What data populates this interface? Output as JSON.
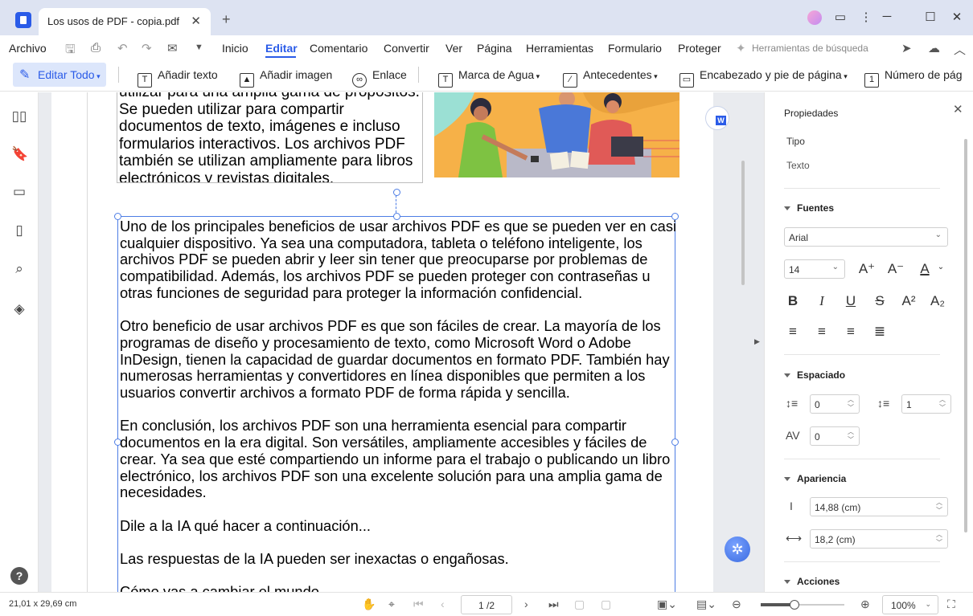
{
  "window": {
    "tab_title": "Los usos de PDF - copia.pdf",
    "tab_close": "✕",
    "new_tab": "+",
    "icons": [
      "avatar",
      "chat-icon",
      "more-icon",
      "minimize-icon",
      "maximize-icon",
      "close-icon"
    ]
  },
  "menu": {
    "file": "Archivo",
    "items": [
      "Inicio",
      "Editar",
      "Comentario",
      "Convertir",
      "Ver",
      "Página",
      "Herramientas",
      "Formulario",
      "Proteger"
    ],
    "active": "Editar",
    "search_tools": "Herramientas de búsqueda"
  },
  "toolbar": {
    "edit_all": "Editar Todo",
    "add_text": "Añadir texto",
    "add_image": "Añadir imagen",
    "link": "Enlace",
    "watermark": "Marca de Agua",
    "background": "Antecedentes",
    "header_footer": "Encabezado y pie de página",
    "page_number": "Número de pág"
  },
  "document": {
    "prev_paragraph": "utilizar para una amplia gama de propósitos. Se pueden utilizar para compartir documentos de texto, imágenes e incluso formularios interactivos. Los archivos PDF también se utilizan ampliamente para libros electrónicos y revistas digitales.",
    "paragraphs": [
      "Uno de los principales beneficios de usar archivos PDF es que se pueden ver en casi cualquier dispositivo. Ya sea una computadora, tableta o teléfono inteligente, los archivos PDF se pueden abrir y leer sin tener que preocuparse por problemas de compatibilidad. Además, los archivos PDF se pueden proteger con contraseñas u otras funciones de seguridad para proteger la información confidencial.",
      "Otro beneficio de usar archivos PDF es que son fáciles de crear. La mayoría de los programas de diseño y procesamiento de texto, como Microsoft Word o Adobe InDesign, tienen la capacidad de guardar documentos en formato PDF. También hay numerosas herramientas y convertidores en línea disponibles que permiten a los usuarios convertir archivos a formato PDF de forma rápida y sencilla.",
      "En conclusión, los archivos PDF son una herramienta esencial para compartir documentos en la era digital. Son versátiles, ampliamente accesibles y fáciles de crear. Ya sea que esté compartiendo un informe para el trabajo o publicando un libro electrónico, los archivos PDF son una excelente solución para una amplia gama de necesidades.",
      "Dile a la IA qué hacer a continuación...",
      "Las respuestas de la IA pueden ser inexactas o engañosas.",
      "Cómo vas a cambiar el mundo"
    ]
  },
  "properties": {
    "title": "Propiedades",
    "type_label": "Tipo",
    "type_value": "Texto",
    "fonts_section": "Fuentes",
    "font_family": "Arial",
    "font_size": "14",
    "spacing_section": "Espaciado",
    "line_spacing": "0",
    "paragraph_spacing": "1",
    "char_spacing": "0",
    "appearance_section": "Apariencia",
    "height": "14,88 (cm)",
    "width": "18,2 (cm)",
    "actions_section": "Acciones"
  },
  "status": {
    "page_size": "21,01 x 29,69 cm",
    "page": "1 /2",
    "zoom": "100%",
    "zoom_level": 0.4
  }
}
